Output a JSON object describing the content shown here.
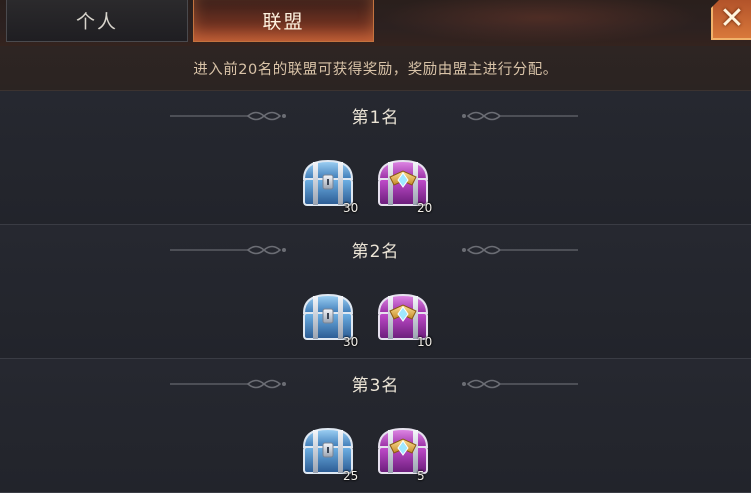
{
  "tabs": [
    {
      "label": "个人",
      "active": false
    },
    {
      "label": "联盟",
      "active": true
    }
  ],
  "close_icon": "close-x-icon",
  "notice": "进入前20名的联盟可获得奖励，奖励由盟主进行分配。",
  "ranks": [
    {
      "title": "第1名",
      "rewards": [
        {
          "icon": "blue-chest-icon",
          "count": "30"
        },
        {
          "icon": "purple-chest-icon",
          "count": "20"
        }
      ]
    },
    {
      "title": "第2名",
      "rewards": [
        {
          "icon": "blue-chest-icon",
          "count": "30"
        },
        {
          "icon": "purple-chest-icon",
          "count": "10"
        }
      ]
    },
    {
      "title": "第3名",
      "rewards": [
        {
          "icon": "blue-chest-icon",
          "count": "25"
        },
        {
          "icon": "purple-chest-icon",
          "count": "5"
        }
      ]
    }
  ],
  "colors": {
    "active_tab": "#a1462a",
    "blue_chest": "#3f7fb8",
    "purple_chest": "#9b2fa6",
    "notice_text": "#d9c3a8"
  }
}
